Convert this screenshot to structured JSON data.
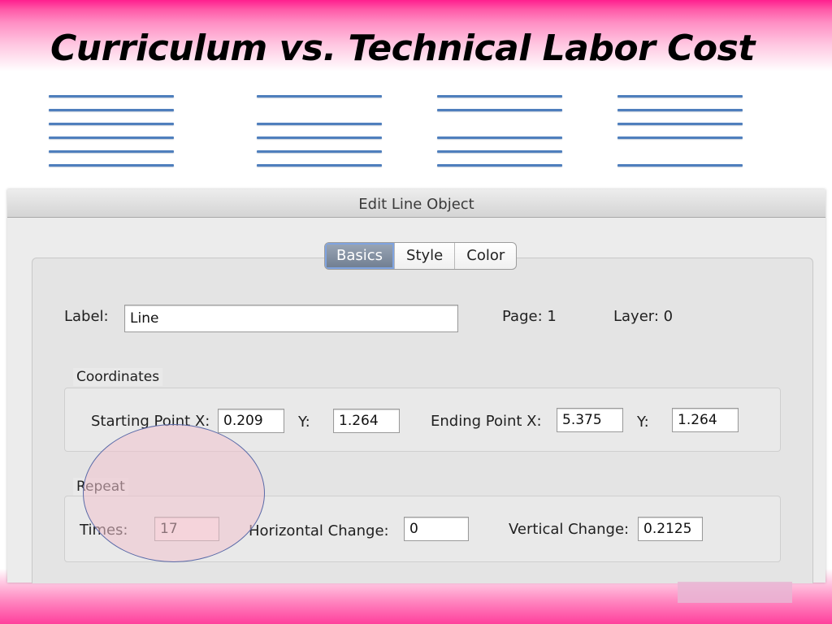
{
  "slide": {
    "title": "Curriculum vs. Technical Labor Cost"
  },
  "dialog": {
    "title": "Edit Line Object",
    "tabs": [
      {
        "label": "Basics",
        "active": true
      },
      {
        "label": "Style",
        "active": false
      },
      {
        "label": "Color",
        "active": false
      }
    ],
    "label_caption": "Label:",
    "label_value": "Line",
    "page_text": "Page: 1",
    "layer_text": "Layer: 0",
    "coordinates": {
      "group_title": "Coordinates",
      "start_x_label": "Starting Point X:",
      "start_x_value": "0.209",
      "start_y_label": "Y:",
      "start_y_value": "1.264",
      "end_x_label": "Ending Point X:",
      "end_x_value": "5.375",
      "end_y_label": "Y:",
      "end_y_value": "1.264"
    },
    "repeat": {
      "group_title": "Repeat",
      "times_label": "Times:",
      "times_value": "17",
      "hchange_label": "Horizontal Change:",
      "hchange_value": "0",
      "vchange_label": "Vertical Change:",
      "vchange_value": "0.2125"
    }
  },
  "colors": {
    "line_accent": "#4f7fbd",
    "band_pink": "#ff1f8e",
    "highlight": "#f0c3cd"
  }
}
